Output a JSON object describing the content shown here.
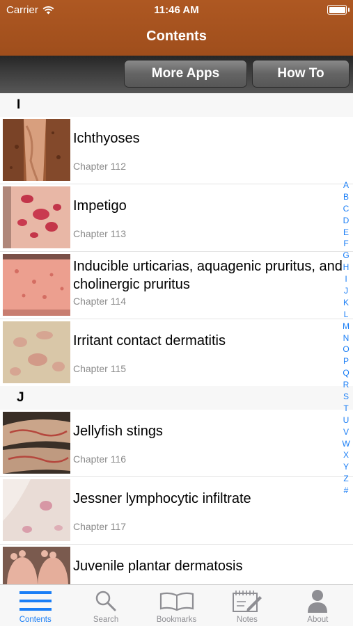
{
  "status": {
    "carrier": "Carrier",
    "time": "11:46 AM"
  },
  "nav": {
    "title": "Contents"
  },
  "toolbar": {
    "more_apps": "More Apps",
    "how_to": "How To"
  },
  "sections": [
    {
      "letter": "I",
      "items": [
        {
          "title": "Ichthyoses",
          "chapter": "Chapter 112"
        },
        {
          "title": "Impetigo",
          "chapter": "Chapter 113"
        },
        {
          "title": "Inducible urticarias, aquagenic pruritus, and cholinergic pruritus",
          "chapter": "Chapter 114"
        },
        {
          "title": "Irritant contact dermatitis",
          "chapter": "Chapter 115"
        }
      ]
    },
    {
      "letter": "J",
      "items": [
        {
          "title": "Jellyfish stings",
          "chapter": "Chapter 116"
        },
        {
          "title": "Jessner lymphocytic infiltrate",
          "chapter": "Chapter 117"
        },
        {
          "title": "Juvenile plantar dermatosis",
          "chapter": ""
        }
      ]
    }
  ],
  "index": [
    "A",
    "B",
    "C",
    "D",
    "E",
    "F",
    "G",
    "H",
    "I",
    "J",
    "K",
    "L",
    "M",
    "N",
    "O",
    "P",
    "Q",
    "R",
    "S",
    "T",
    "U",
    "V",
    "W",
    "X",
    "Y",
    "Z",
    "#"
  ],
  "tabs": [
    {
      "label": "Contents",
      "icon": "list-icon",
      "active": true
    },
    {
      "label": "Search",
      "icon": "search-icon"
    },
    {
      "label": "Bookmarks",
      "icon": "book-icon"
    },
    {
      "label": "Notes",
      "icon": "notes-icon"
    },
    {
      "label": "About",
      "icon": "person-icon"
    }
  ],
  "colors": {
    "nav": "#a8531f",
    "accent": "#1a7ef6",
    "inactive": "#8e8e93"
  }
}
